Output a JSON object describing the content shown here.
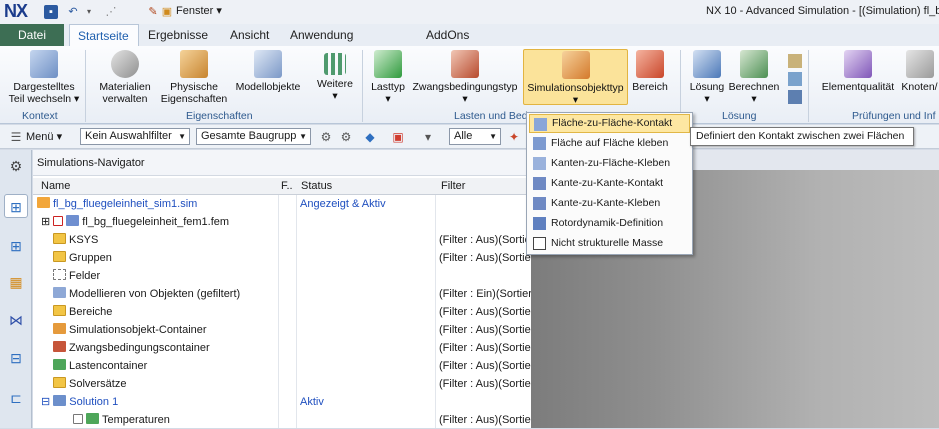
{
  "window": {
    "app_logo": "NX",
    "title": "NX 10 - Advanced Simulation - [(Simulation) fl_b",
    "fenster_menu": "Fenster ▾"
  },
  "tabs": [
    {
      "label": "Datei"
    },
    {
      "label": "Startseite"
    },
    {
      "label": "Ergebnisse"
    },
    {
      "label": "Ansicht"
    },
    {
      "label": "Anwendung"
    },
    {
      "label": "AddOns"
    }
  ],
  "ribbon": {
    "buttons": [
      {
        "label1": "Dargestelltes",
        "label2": "Teil wechseln ▾"
      },
      {
        "label1": "Materialien",
        "label2": "verwalten"
      },
      {
        "label1": "Physische",
        "label2": "Eigenschaften"
      },
      {
        "label1": "Modellobjekte",
        "label2": ""
      },
      {
        "label1": "Weitere",
        "label2": "▾"
      },
      {
        "label1": "Lasttyp",
        "label2": "▾"
      },
      {
        "label1": "Zwangsbedingungstyp",
        "label2": "▾"
      },
      {
        "label1": "Simulationsobjekttyp",
        "label2": "▾"
      },
      {
        "label1": "Bereich",
        "label2": ""
      },
      {
        "label1": "Lösung",
        "label2": "▾"
      },
      {
        "label1": "Berechnen",
        "label2": "▾"
      },
      {
        "label1": "Elementqualität",
        "label2": ""
      },
      {
        "label1": "Knoten/",
        "label2": ""
      }
    ],
    "groups": [
      "Kontext",
      "Eigenschaften",
      "Lasten und Bed",
      "Lösung",
      "Prüfungen und Inf"
    ]
  },
  "toolbar": {
    "menu_label": "Menü ▾",
    "filter_value": "Kein Auswahlfilter",
    "scope_value": "Gesamte Baugrupp",
    "alle_value": "Alle"
  },
  "navigator": {
    "title": "Simulations-Navigator",
    "columns": {
      "name": "Name",
      "f": "F..",
      "status": "Status",
      "filter": "Filter"
    },
    "rows": [
      {
        "name": "fl_bg_fluegeleinheit_sim1.sim",
        "status": "Angezeigt & Aktiv",
        "filter": ""
      },
      {
        "name": "fl_bg_fluegeleinheit_fem1.fem",
        "status": "",
        "filter": ""
      },
      {
        "name": "KSYS",
        "status": "",
        "filter": "(Filter : Aus)(Sortier"
      },
      {
        "name": "Gruppen",
        "status": "",
        "filter": "(Filter : Aus)(Sortier"
      },
      {
        "name": "Felder",
        "status": "",
        "filter": ""
      },
      {
        "name": "Modellieren von Objekten (gefiltert)",
        "status": "",
        "filter": "(Filter : Ein)(Sortier"
      },
      {
        "name": "Bereiche",
        "status": "",
        "filter": "(Filter : Aus)(Sortier"
      },
      {
        "name": "Simulationsobjekt-Container",
        "status": "",
        "filter": "(Filter : Aus)(Sortier"
      },
      {
        "name": "Zwangsbedingungscontainer",
        "status": "",
        "filter": "(Filter : Aus)(Sortier"
      },
      {
        "name": "Lastencontainer",
        "status": "",
        "filter": "(Filter : Aus)(Sortier"
      },
      {
        "name": "Solversätze",
        "status": "",
        "filter": "(Filter : Aus)(Sortier"
      },
      {
        "name": "Solution 1",
        "status": "Aktiv",
        "filter": ""
      },
      {
        "name": "Temperaturen",
        "status": "",
        "filter": "(Filter : Aus)(Sortier"
      }
    ]
  },
  "dropdown": {
    "items": [
      {
        "label": "Fläche-zu-Fläche-Kontakt"
      },
      {
        "label": "Fläche auf Fläche kleben"
      },
      {
        "label": "Kanten-zu-Fläche-Kleben"
      },
      {
        "label": "Kante-zu-Kante-Kontakt"
      },
      {
        "label": "Kante-zu-Kante-Kleben"
      },
      {
        "label": "Rotordynamik-Definition"
      },
      {
        "label": "Nicht strukturelle Masse"
      }
    ]
  },
  "tooltip": {
    "text": "Definiert den Kontakt zwischen zwei Flächen"
  },
  "colors": {
    "accent": "#1f5fae",
    "datei_tab": "#3d6e54",
    "highlight": "#fde7a2"
  }
}
